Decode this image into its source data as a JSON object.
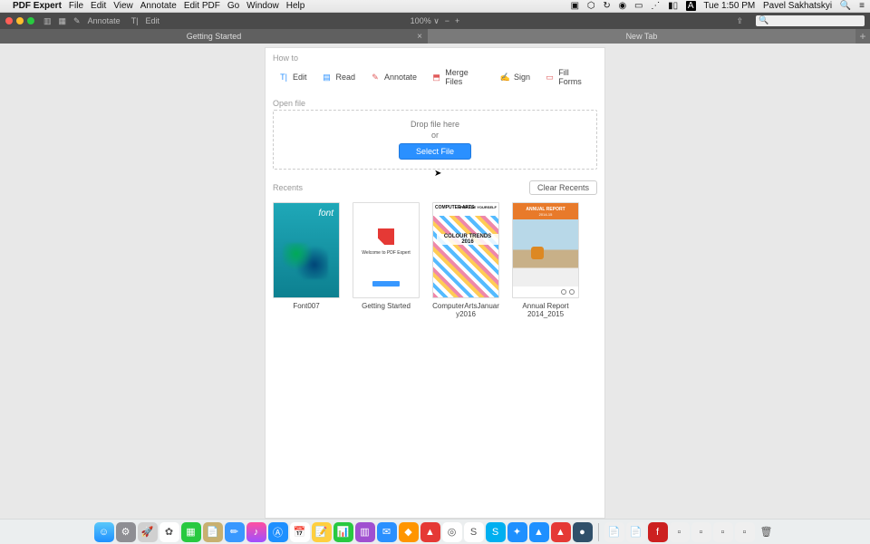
{
  "menubar": {
    "app": "PDF Expert",
    "items": [
      "File",
      "Edit",
      "View",
      "Annotate",
      "Edit PDF",
      "Go",
      "Window",
      "Help"
    ],
    "clock": "Tue 1:50 PM",
    "user": "Pavel Sakhatskyi"
  },
  "toolbar": {
    "annotate": "Annotate",
    "edit": "Edit",
    "zoom": "100% ∨",
    "search_placeholder": " "
  },
  "tabs": {
    "inactive": "Getting Started",
    "active": "New Tab"
  },
  "howto": {
    "head": "How to",
    "items": [
      {
        "label": "Edit",
        "name": "howto-edit",
        "icon": "text-icon",
        "color": "#2a90ff"
      },
      {
        "label": "Read",
        "name": "howto-read",
        "icon": "book-icon",
        "color": "#2a90ff"
      },
      {
        "label": "Annotate",
        "name": "howto-annotate",
        "icon": "pen-icon",
        "color": "#e05a5a"
      },
      {
        "label": "Merge Files",
        "name": "howto-merge",
        "icon": "merge-icon",
        "color": "#e05a5a"
      },
      {
        "label": "Sign",
        "name": "howto-sign",
        "icon": "sign-icon",
        "color": "#555555"
      },
      {
        "label": "Fill Forms",
        "name": "howto-fillforms",
        "icon": "form-icon",
        "color": "#e05a5a"
      }
    ]
  },
  "openfile": {
    "head": "Open file",
    "drop": "Drop file here",
    "or": "or",
    "select": "Select File"
  },
  "recents": {
    "head": "Recents",
    "clear": "Clear Recents",
    "items": [
      {
        "label": "Font007",
        "name": "recent-font007",
        "thumb": "font007"
      },
      {
        "label": "Getting Started",
        "name": "recent-getting",
        "thumb": "getting"
      },
      {
        "label": "ComputerArtsJanuary2016",
        "name": "recent-carts",
        "thumb": "carts"
      },
      {
        "label": "Annual Report 2014_2015",
        "name": "recent-annual",
        "thumb": "annual"
      }
    ]
  },
  "thumbs": {
    "getting_text": "Welcome to PDF Expert",
    "carts_head": "COMPUTER ARTS",
    "carts_upg": "UPGRADE YOURSELF",
    "carts_mid": "COLOUR TRENDS 2016",
    "annual_t1": "ANNUAL REPORT",
    "annual_t2": "2014-15"
  },
  "dock": {
    "apps": [
      {
        "name": "finder",
        "bg": "linear-gradient(#5ac8fa,#1e90ff)",
        "glyph": "☺"
      },
      {
        "name": "sysprefs",
        "bg": "#8e8e93",
        "glyph": "⚙"
      },
      {
        "name": "launchpad",
        "bg": "#d0d0d0",
        "glyph": "🚀"
      },
      {
        "name": "photos",
        "bg": "#fff",
        "glyph": "✿"
      },
      {
        "name": "spreadsheet",
        "bg": "#28c940",
        "glyph": "▦"
      },
      {
        "name": "notes1",
        "bg": "#c8b070",
        "glyph": "📄"
      },
      {
        "name": "brush",
        "bg": "#3898ff",
        "glyph": "✏"
      },
      {
        "name": "itunes",
        "bg": "linear-gradient(#ff4fa0,#a04fff)",
        "glyph": "♪"
      },
      {
        "name": "appstore",
        "bg": "#1e90ff",
        "glyph": "Ⓐ"
      },
      {
        "name": "calendar",
        "bg": "#fff",
        "glyph": "📅"
      },
      {
        "name": "notes2",
        "bg": "#ffcf3f",
        "glyph": "📝"
      },
      {
        "name": "numbers",
        "bg": "#28c940",
        "glyph": "📊"
      },
      {
        "name": "charts",
        "bg": "#a050d0",
        "glyph": "▥"
      },
      {
        "name": "mail",
        "bg": "#2a90ff",
        "glyph": "✉"
      },
      {
        "name": "sketch",
        "bg": "#ff9500",
        "glyph": "◆"
      },
      {
        "name": "pdfexpert",
        "bg": "#e53935",
        "glyph": "▲"
      },
      {
        "name": "chrome",
        "bg": "#fff",
        "glyph": "◎"
      },
      {
        "name": "slack",
        "bg": "#fff",
        "glyph": "S"
      },
      {
        "name": "skype",
        "bg": "#00aff0",
        "glyph": "S"
      },
      {
        "name": "safari",
        "bg": "#1e90ff",
        "glyph": "✦"
      },
      {
        "name": "nav",
        "bg": "#1e90ff",
        "glyph": "▲"
      },
      {
        "name": "pdf2",
        "bg": "#e53935",
        "glyph": "▲"
      },
      {
        "name": "dark",
        "bg": "#30506a",
        "glyph": "●"
      }
    ],
    "right": [
      {
        "name": "dock-doc1",
        "bg": "#efefef",
        "glyph": "📄"
      },
      {
        "name": "dock-doc2",
        "bg": "#efefef",
        "glyph": "📄"
      },
      {
        "name": "dock-flash",
        "bg": "#cc2020",
        "glyph": "f"
      },
      {
        "name": "dock-app1",
        "bg": "#efefef",
        "glyph": "▫"
      },
      {
        "name": "dock-app2",
        "bg": "#efefef",
        "glyph": "▫"
      },
      {
        "name": "dock-app3",
        "bg": "#efefef",
        "glyph": "▫"
      },
      {
        "name": "dock-app4",
        "bg": "#efefef",
        "glyph": "▫"
      },
      {
        "name": "trash",
        "bg": "transparent",
        "glyph": "🗑"
      }
    ]
  }
}
